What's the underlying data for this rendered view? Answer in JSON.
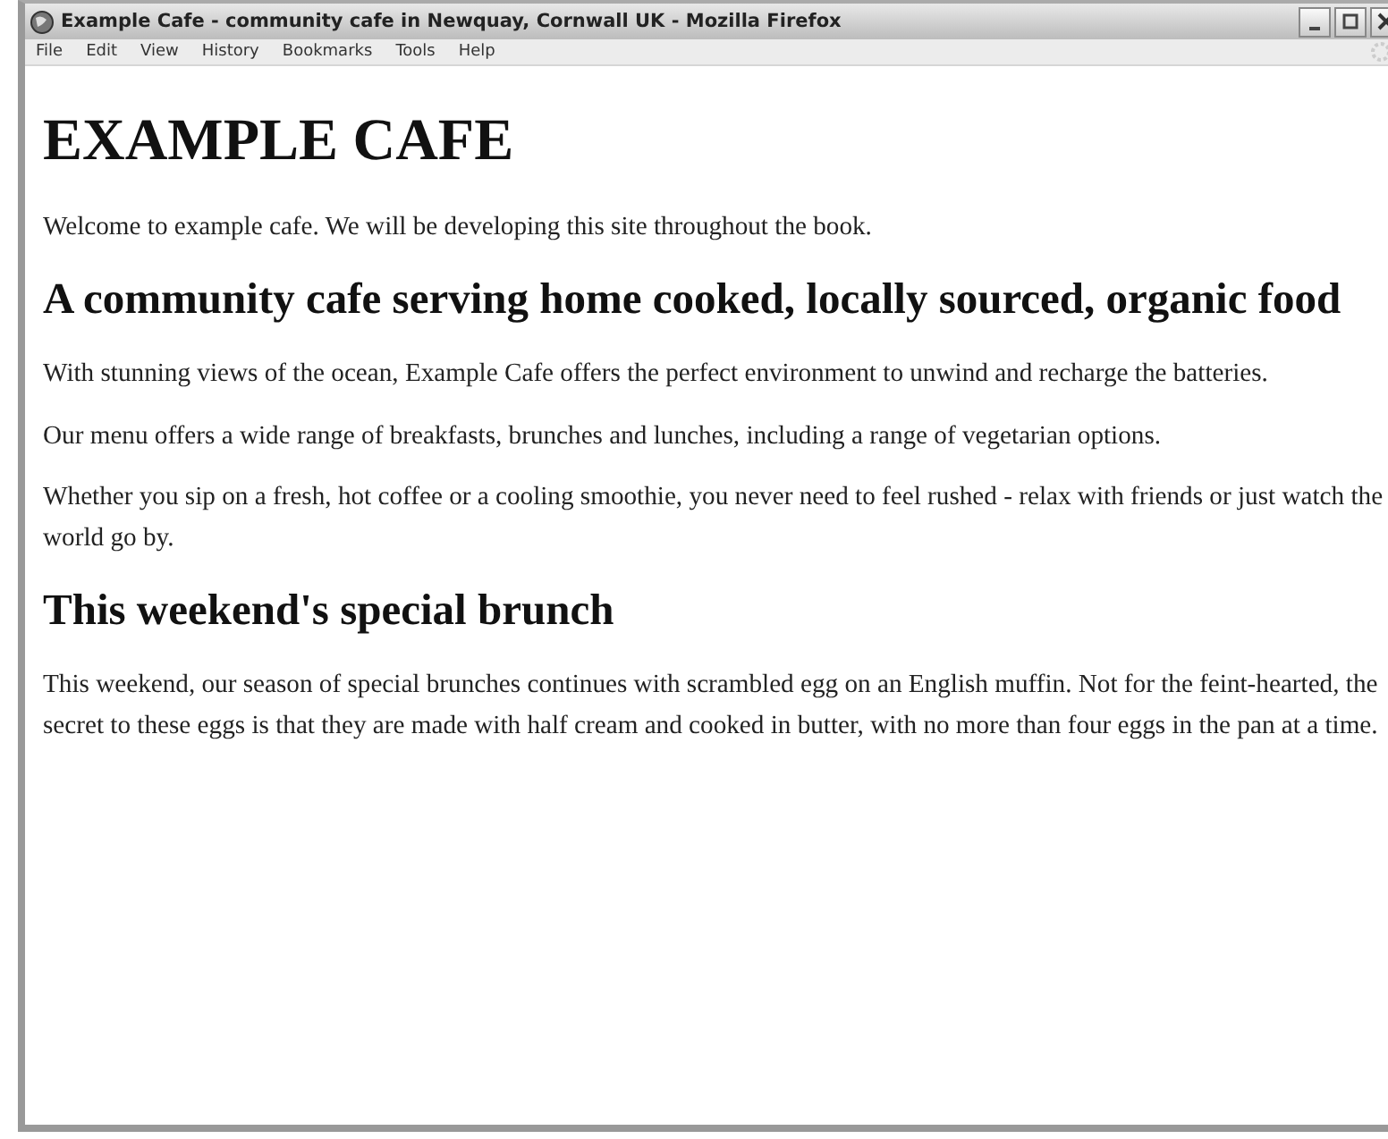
{
  "window": {
    "title": "Example Cafe - community cafe in Newquay, Cornwall UK - Mozilla Firefox"
  },
  "menu": [
    "File",
    "Edit",
    "View",
    "History",
    "Bookmarks",
    "Tools",
    "Help"
  ],
  "page": [
    {
      "kind": "h1",
      "text": "EXAMPLE CAFE"
    },
    {
      "kind": "p",
      "text": "Welcome to example cafe. We will be developing this site throughout the book."
    },
    {
      "kind": "h2",
      "text": "A community cafe serving home cooked, locally sourced, organic food"
    },
    {
      "kind": "p",
      "text": "With stunning views of the ocean, Example Cafe offers the perfect environment to unwind and recharge the batteries."
    },
    {
      "kind": "p",
      "text": "Our menu offers a wide range of breakfasts, brunches and lunches, including a range of vegetarian options."
    },
    {
      "kind": "p",
      "text": "Whether you sip on a fresh, hot coffee or a cooling smoothie, you never need to feel rushed - relax with friends or just watch the world go by."
    },
    {
      "kind": "h2",
      "text": "This weekend's special brunch"
    },
    {
      "kind": "p",
      "text": "This weekend, our season of special brunches continues with scrambled egg on an English muffin. Not for the feint-hearted, the secret to these eggs is that they are made with half cream and cooked in butter, with no more than four eggs in the pan at a time."
    }
  ]
}
